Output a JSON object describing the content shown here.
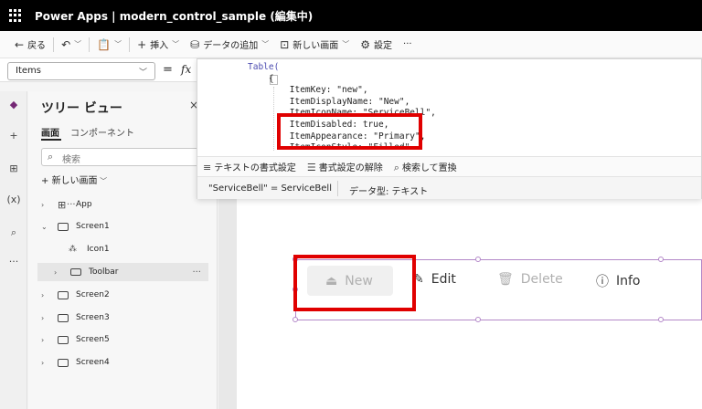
{
  "titlebar": {
    "title": "Power Apps  |  modern_control_sample (編集中)"
  },
  "commandbar": {
    "back": "戻る",
    "insert": "挿入",
    "add_data": "データの追加",
    "new_screen": "新しい画面",
    "settings": "設定",
    "more": "···"
  },
  "formula": {
    "property": "Items",
    "eq": "=",
    "fx": "fx"
  },
  "code_lines": [
    "Table(",
    "    {",
    "        ItemKey: \"new\",",
    "        ItemDisplayName: \"New\",",
    "        ItemIconName: \"ServiceBell\",",
    "        ItemDisabled: true,",
    "        ItemAppearance: \"Primary\",",
    "        ItemIconStyle: \"Filled\""
  ],
  "popup": {
    "format_text": "テキストの書式設定",
    "remove_format": "書式設定の解除",
    "find_replace": "検索して置換",
    "result": "\"ServiceBell\"  =  ServiceBell",
    "data_type": "データ型: テキスト"
  },
  "tree": {
    "title": "ツリー ビュー",
    "tab_screens": "画面",
    "tab_components": "コンポーネント",
    "search_placeholder": "検索",
    "new_screen": "新しい画面",
    "nodes": {
      "app": "App",
      "screen1": "Screen1",
      "icon1": "Icon1",
      "toolbar": "Toolbar",
      "screen2": "Screen2",
      "screen3": "Screen3",
      "screen5": "Screen5",
      "screen4": "Screen4"
    }
  },
  "toolbar_control": {
    "new": "New",
    "edit": "Edit",
    "delete": "Delete",
    "info": "Info"
  },
  "colors": {
    "highlight": "#e00000",
    "selection": "#b388c8",
    "brand": "#742774"
  }
}
